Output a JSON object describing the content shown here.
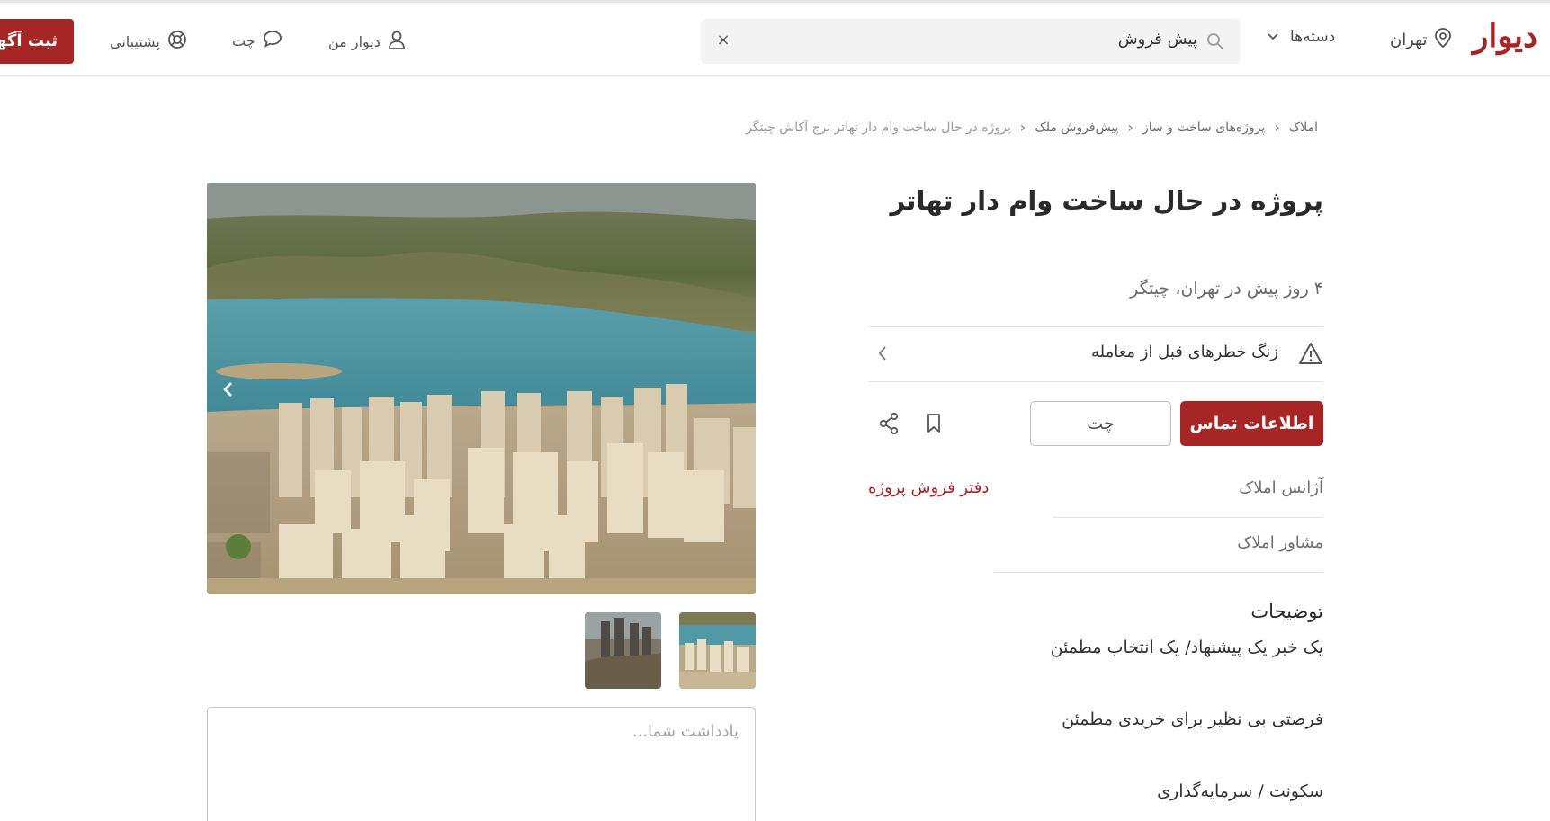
{
  "header": {
    "logo": "دیوار",
    "city": "تهران",
    "categories_label": "دسته‌ها",
    "search": {
      "value": "پیش فروش",
      "clear": "×"
    },
    "my_divar": "دیوار من",
    "chat": "چت",
    "support": "پشتیبانی",
    "post_ad": "ثبت آگهی"
  },
  "breadcrumb": {
    "items": [
      "املاک",
      "پروژه‌های ساخت و ساز",
      "پیش‌فروش ملک"
    ],
    "current": "پروژه در حال ساخت وام دار تهاتر برج آکاش چیتگر"
  },
  "listing": {
    "title": "پروژه در حال ساخت وام دار تهاتر",
    "subtitle": "۴ روز پیش در تهران، چیتگر",
    "warning": "زنگ خطرهای قبل از معامله",
    "contact_button": "اطلاعات تماس",
    "chat_button": "چت",
    "info": [
      {
        "label": "آژانس املاک",
        "value": "دفتر فروش پروژه"
      },
      {
        "label": "مشاور املاک",
        "value": ""
      }
    ],
    "description_title": "توضیحات",
    "description_lines": [
      "یک خبر یک پیشنهاد/ یک انتخاب مطمئن",
      "فرصتی بی نظیر برای خریدی مطمئن",
      "سکونت / سرمایه‌گذاری"
    ]
  },
  "gallery": {
    "note_placeholder": "یادداشت شما..."
  },
  "icons": {
    "city": "location-pin-icon",
    "categories": "chevron-down-icon",
    "search": "search-icon",
    "my_divar": "user-icon",
    "chat": "chat-bubble-icon",
    "support": "lifebuoy-icon",
    "warning": "warning-triangle-icon",
    "bookmark": "bookmark-icon",
    "share": "share-icon"
  },
  "colors": {
    "brand": "#a62626",
    "search_bg": "#f3f3f3",
    "lake": "#4f9aa6"
  }
}
